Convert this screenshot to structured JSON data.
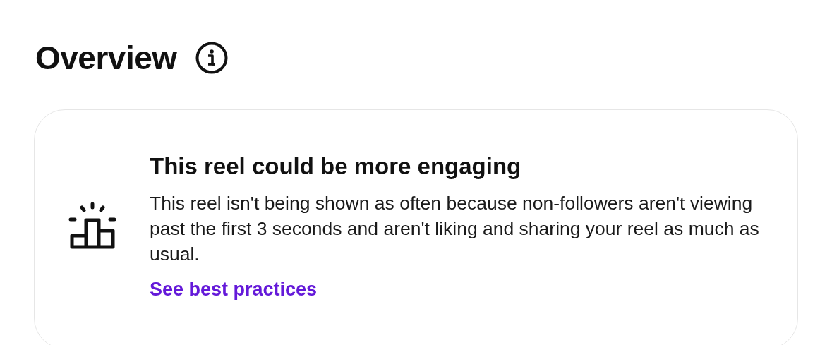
{
  "heading": {
    "title": "Overview"
  },
  "card": {
    "title": "This reel could be more engaging",
    "body": "This reel isn't being shown as often because non-followers aren't viewing past the first 3 seconds and aren't liking and sharing your reel as much as usual.",
    "link": "See best practices"
  }
}
